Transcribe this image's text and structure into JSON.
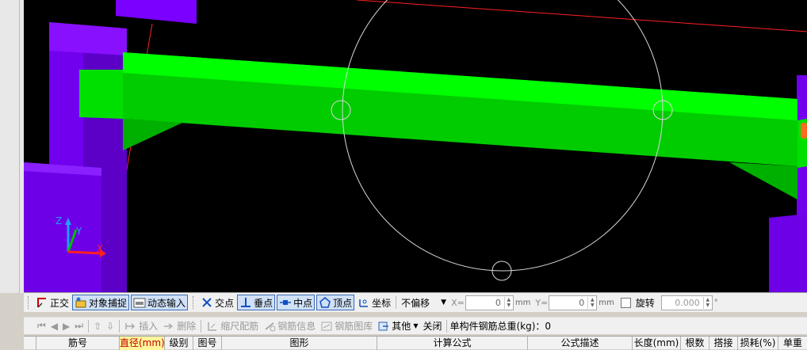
{
  "toolbar1": {
    "ortho": "正交",
    "object_snap": "对象捕捉",
    "dynamic_input": "动态输入",
    "intersection": "交点",
    "perpendicular": "垂点",
    "midpoint": "中点",
    "vertex": "顶点",
    "coordinate": "坐标",
    "offset_select": "不偏移",
    "x_label": "X=",
    "x_value": "0",
    "x_unit": "mm",
    "y_label": "Y=",
    "y_value": "0",
    "y_unit": "mm",
    "rotate_label": "旋转",
    "rotate_value": "0.000",
    "rotate_unit": "°"
  },
  "toolbar2": {
    "insert": "插入",
    "delete": "删除",
    "scale_rebar": "缩尺配筋",
    "rebar_info": "钢筋信息",
    "rebar_library": "钢筋图库",
    "other": "其他",
    "close": "关闭",
    "total_weight_label": "单构件钢筋总重(kg)：",
    "total_weight_value": "0"
  },
  "table": {
    "columns": [
      "筋号",
      "直径(mm)",
      "级别",
      "图号",
      "图形",
      "计算公式",
      "公式描述",
      "长度(mm)",
      "根数",
      "搭接",
      "损耗(%)",
      "单重"
    ]
  },
  "viewport": {
    "axis_z": "Z",
    "axis_y": "Y",
    "axis_x": "X",
    "colors": {
      "beam": "#00ff00",
      "beam_shade": "#00cc00",
      "column": "#7b00ff",
      "column_shade": "#5a00c0",
      "background": "#000000"
    }
  }
}
